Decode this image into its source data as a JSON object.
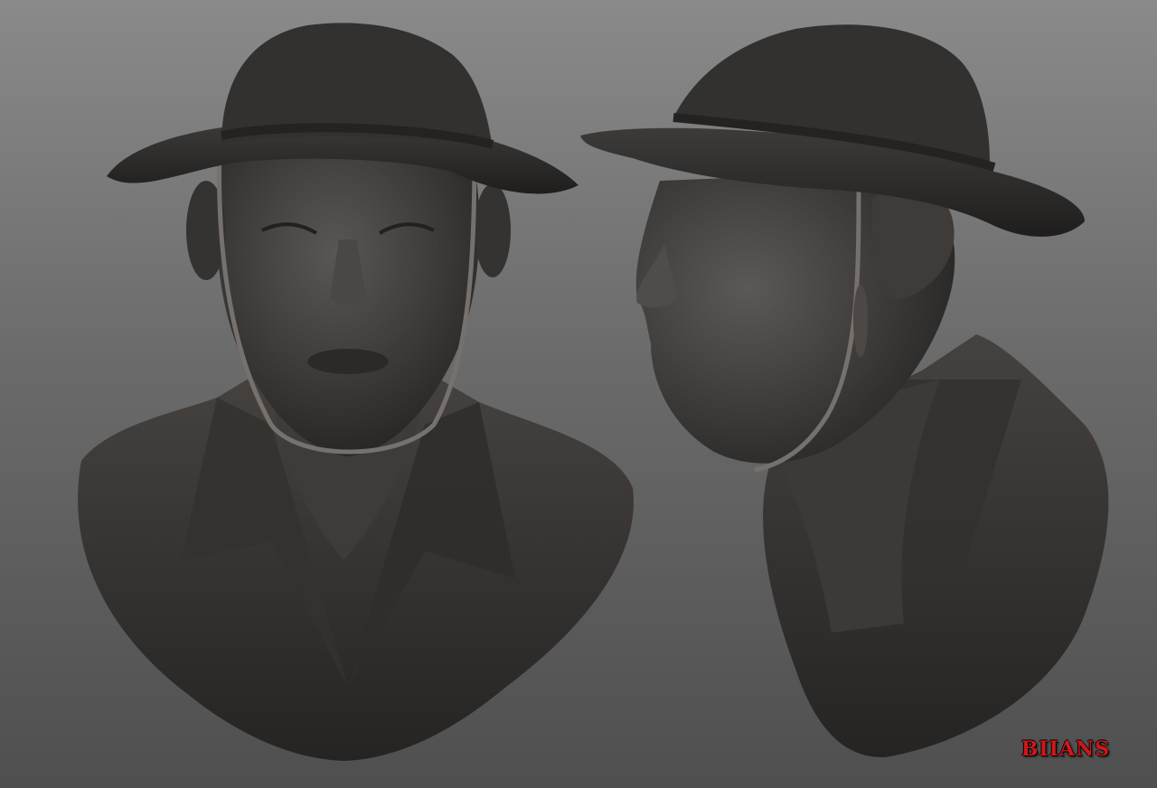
{
  "scene": {
    "background_top": "#8a8a8a",
    "background_bottom": "#4f4f4f",
    "material_color": "#3a3837",
    "views": [
      "front-view",
      "side-view"
    ]
  },
  "signature": {
    "text": "BIIANS",
    "color": "#d0181a"
  }
}
